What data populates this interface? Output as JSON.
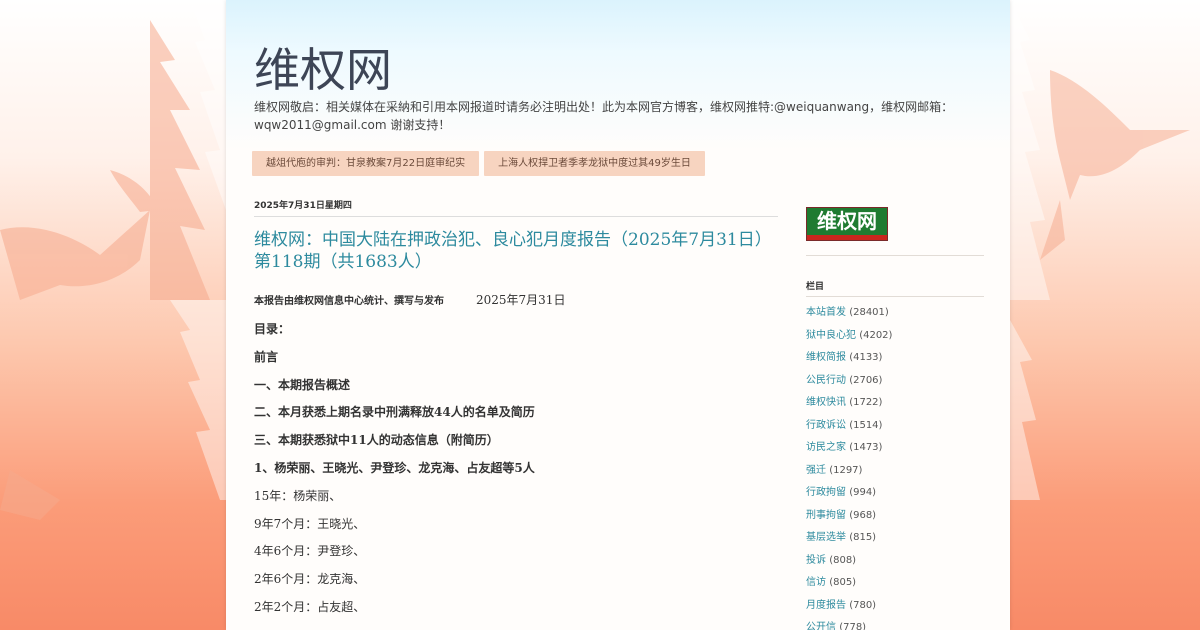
{
  "header": {
    "title": "维权网",
    "description": "维权网敬启：相关媒体在采納和引用本网报道时请务必注明出处！此为本网官方博客，维权网推特:@weiquanwang，维权网邮箱：wqw2011@gmail.com 谢谢支持！"
  },
  "tabs": [
    {
      "label": "越俎代庖的审判：甘泉教案7月22日庭审纪实"
    },
    {
      "label": "上海人权捍卫者季孝龙狱中度过其49岁生日"
    }
  ],
  "post": {
    "date_header": "2025年7月31日星期四",
    "title": "维权网：中国大陆在押政治犯、良心犯月度报告（2025年7月31日）第118期（共1683人）",
    "byline": "本报告由维权网信息中心统计、撰写与发布",
    "byline_date": "2025年7月31日",
    "lines": [
      {
        "text": "目录："
      },
      {
        "text": "前言"
      },
      {
        "text": "一、本期报告概述"
      },
      {
        "text": "二、本月获悉上期名录中刑满释放44人的名单及简历"
      },
      {
        "text": "三、本期获悉狱中11人的动态信息（附简历）"
      },
      {
        "text": "1、杨荣丽、王晓光、尹登珍、龙克海、占友超等5人"
      },
      {
        "text": "15年：杨荣丽、"
      },
      {
        "text": "9年7个月：王晓光、"
      },
      {
        "text": "4年6个月：尹登珍、"
      },
      {
        "text": "2年6个月：龙克海、"
      },
      {
        "text": "2年2个月：占友超、"
      }
    ]
  },
  "sidebar": {
    "logo_text": "维权网",
    "widget_title": "栏目",
    "categories": [
      {
        "name": "本站首发",
        "count": "(28401)"
      },
      {
        "name": "狱中良心犯",
        "count": "(4202)"
      },
      {
        "name": "维权简报",
        "count": "(4133)"
      },
      {
        "name": "公民行动",
        "count": "(2706)"
      },
      {
        "name": "维权快讯",
        "count": "(1722)"
      },
      {
        "name": "行政诉讼",
        "count": "(1514)"
      },
      {
        "name": "访民之家",
        "count": "(1473)"
      },
      {
        "name": "强迁",
        "count": "(1297)"
      },
      {
        "name": "行政拘留",
        "count": "(994)"
      },
      {
        "name": "刑事拘留",
        "count": "(968)"
      },
      {
        "name": "基层选举",
        "count": "(815)"
      },
      {
        "name": "投诉",
        "count": "(808)"
      },
      {
        "name": "信访",
        "count": "(805)"
      },
      {
        "name": "月度报告",
        "count": "(780)"
      },
      {
        "name": "公开信",
        "count": "(778)"
      }
    ]
  },
  "colors": {
    "link": "#2d8a9e",
    "tab_bg": "#f7d4c0",
    "logo_green": "#1f7b31",
    "logo_red": "#c9261e"
  }
}
